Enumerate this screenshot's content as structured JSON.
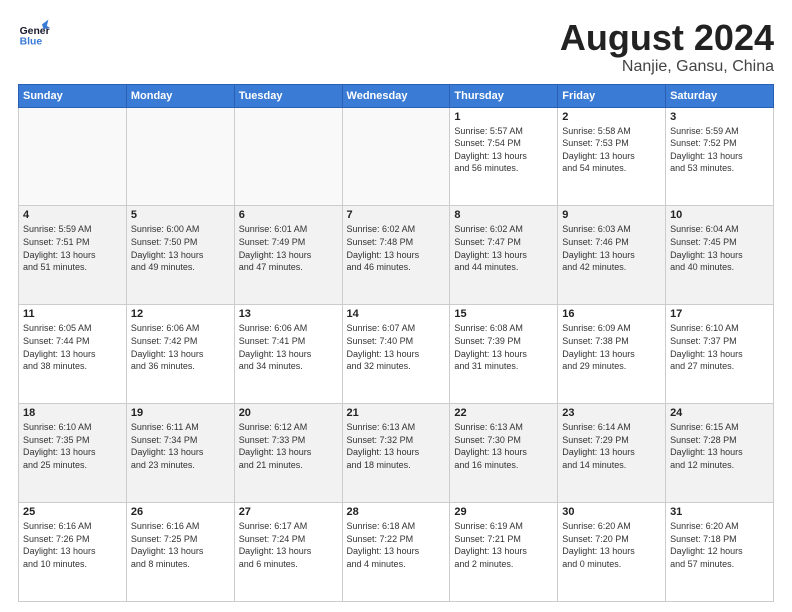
{
  "header": {
    "logo_general": "General",
    "logo_blue": "Blue",
    "month": "August 2024",
    "location": "Nanjie, Gansu, China"
  },
  "days_of_week": [
    "Sunday",
    "Monday",
    "Tuesday",
    "Wednesday",
    "Thursday",
    "Friday",
    "Saturday"
  ],
  "weeks": [
    [
      {
        "day": "",
        "info": ""
      },
      {
        "day": "",
        "info": ""
      },
      {
        "day": "",
        "info": ""
      },
      {
        "day": "",
        "info": ""
      },
      {
        "day": "1",
        "info": "Sunrise: 5:57 AM\nSunset: 7:54 PM\nDaylight: 13 hours\nand 56 minutes."
      },
      {
        "day": "2",
        "info": "Sunrise: 5:58 AM\nSunset: 7:53 PM\nDaylight: 13 hours\nand 54 minutes."
      },
      {
        "day": "3",
        "info": "Sunrise: 5:59 AM\nSunset: 7:52 PM\nDaylight: 13 hours\nand 53 minutes."
      }
    ],
    [
      {
        "day": "4",
        "info": "Sunrise: 5:59 AM\nSunset: 7:51 PM\nDaylight: 13 hours\nand 51 minutes."
      },
      {
        "day": "5",
        "info": "Sunrise: 6:00 AM\nSunset: 7:50 PM\nDaylight: 13 hours\nand 49 minutes."
      },
      {
        "day": "6",
        "info": "Sunrise: 6:01 AM\nSunset: 7:49 PM\nDaylight: 13 hours\nand 47 minutes."
      },
      {
        "day": "7",
        "info": "Sunrise: 6:02 AM\nSunset: 7:48 PM\nDaylight: 13 hours\nand 46 minutes."
      },
      {
        "day": "8",
        "info": "Sunrise: 6:02 AM\nSunset: 7:47 PM\nDaylight: 13 hours\nand 44 minutes."
      },
      {
        "day": "9",
        "info": "Sunrise: 6:03 AM\nSunset: 7:46 PM\nDaylight: 13 hours\nand 42 minutes."
      },
      {
        "day": "10",
        "info": "Sunrise: 6:04 AM\nSunset: 7:45 PM\nDaylight: 13 hours\nand 40 minutes."
      }
    ],
    [
      {
        "day": "11",
        "info": "Sunrise: 6:05 AM\nSunset: 7:44 PM\nDaylight: 13 hours\nand 38 minutes."
      },
      {
        "day": "12",
        "info": "Sunrise: 6:06 AM\nSunset: 7:42 PM\nDaylight: 13 hours\nand 36 minutes."
      },
      {
        "day": "13",
        "info": "Sunrise: 6:06 AM\nSunset: 7:41 PM\nDaylight: 13 hours\nand 34 minutes."
      },
      {
        "day": "14",
        "info": "Sunrise: 6:07 AM\nSunset: 7:40 PM\nDaylight: 13 hours\nand 32 minutes."
      },
      {
        "day": "15",
        "info": "Sunrise: 6:08 AM\nSunset: 7:39 PM\nDaylight: 13 hours\nand 31 minutes."
      },
      {
        "day": "16",
        "info": "Sunrise: 6:09 AM\nSunset: 7:38 PM\nDaylight: 13 hours\nand 29 minutes."
      },
      {
        "day": "17",
        "info": "Sunrise: 6:10 AM\nSunset: 7:37 PM\nDaylight: 13 hours\nand 27 minutes."
      }
    ],
    [
      {
        "day": "18",
        "info": "Sunrise: 6:10 AM\nSunset: 7:35 PM\nDaylight: 13 hours\nand 25 minutes."
      },
      {
        "day": "19",
        "info": "Sunrise: 6:11 AM\nSunset: 7:34 PM\nDaylight: 13 hours\nand 23 minutes."
      },
      {
        "day": "20",
        "info": "Sunrise: 6:12 AM\nSunset: 7:33 PM\nDaylight: 13 hours\nand 21 minutes."
      },
      {
        "day": "21",
        "info": "Sunrise: 6:13 AM\nSunset: 7:32 PM\nDaylight: 13 hours\nand 18 minutes."
      },
      {
        "day": "22",
        "info": "Sunrise: 6:13 AM\nSunset: 7:30 PM\nDaylight: 13 hours\nand 16 minutes."
      },
      {
        "day": "23",
        "info": "Sunrise: 6:14 AM\nSunset: 7:29 PM\nDaylight: 13 hours\nand 14 minutes."
      },
      {
        "day": "24",
        "info": "Sunrise: 6:15 AM\nSunset: 7:28 PM\nDaylight: 13 hours\nand 12 minutes."
      }
    ],
    [
      {
        "day": "25",
        "info": "Sunrise: 6:16 AM\nSunset: 7:26 PM\nDaylight: 13 hours\nand 10 minutes."
      },
      {
        "day": "26",
        "info": "Sunrise: 6:16 AM\nSunset: 7:25 PM\nDaylight: 13 hours\nand 8 minutes."
      },
      {
        "day": "27",
        "info": "Sunrise: 6:17 AM\nSunset: 7:24 PM\nDaylight: 13 hours\nand 6 minutes."
      },
      {
        "day": "28",
        "info": "Sunrise: 6:18 AM\nSunset: 7:22 PM\nDaylight: 13 hours\nand 4 minutes."
      },
      {
        "day": "29",
        "info": "Sunrise: 6:19 AM\nSunset: 7:21 PM\nDaylight: 13 hours\nand 2 minutes."
      },
      {
        "day": "30",
        "info": "Sunrise: 6:20 AM\nSunset: 7:20 PM\nDaylight: 13 hours\nand 0 minutes."
      },
      {
        "day": "31",
        "info": "Sunrise: 6:20 AM\nSunset: 7:18 PM\nDaylight: 12 hours\nand 57 minutes."
      }
    ]
  ]
}
